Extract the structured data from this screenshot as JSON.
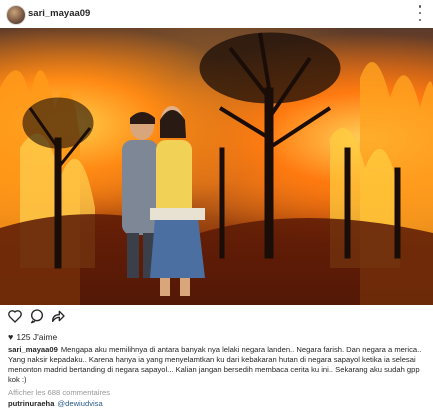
{
  "post": {
    "username": "sari_mayaa09",
    "more_icon": "more-vertical-icon"
  },
  "photo": {
    "alt": "photo"
  },
  "actions": {
    "like_icon": "heart-outline-icon",
    "comment_icon": "comment-icon",
    "share_icon": "share-icon"
  },
  "likes": {
    "count_label": "125 J'aime"
  },
  "caption": {
    "username": "sari_mayaa09",
    "text": "Mengapa aku memilihnya di antara banyak nya lelaki negara landen.. Negara farish. Dan negara a merica.. Yang naksir kepadaku.. Karena hanya ia yang menyelamtkan ku dari kebakaran hutan di negara sapayol ketika ia selesai menonton madrid bertanding di negara sapayol... Kalian jangan bersedih membaca cerita ku ini.. Sekarang aku sudah gpp kok :)"
  },
  "comments": {
    "view_all_label": "Afficher les 688 commentaires",
    "peek_user": "putrinuraeha",
    "peek_mention": "@dewiudvisa"
  },
  "colors": {
    "text": "#262626",
    "muted": "#999999",
    "fire_orange": "#ff7a10"
  }
}
